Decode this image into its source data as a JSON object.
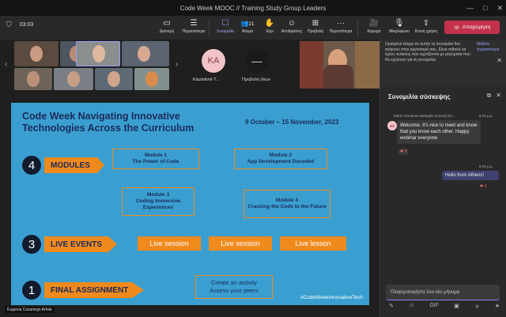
{
  "window": {
    "title": "Code Week MOOC // Training Study Group Leaders",
    "controls": [
      "—",
      "□",
      "✕"
    ]
  },
  "toolbar": {
    "timer": "03:03",
    "items": [
      {
        "icon": "▭",
        "label": "Διανομή"
      },
      {
        "icon": "☰",
        "label": "Περισσότερα"
      },
      {
        "icon": "☐",
        "label": "Συνομιλία"
      },
      {
        "icon": "👥",
        "label": "Άτομα"
      },
      {
        "icon": "✋",
        "label": "Χέρι"
      },
      {
        "icon": "☺",
        "label": "Αντιδράσεις"
      },
      {
        "icon": "⊞",
        "label": "Προβολή"
      },
      {
        "icon": "···",
        "label": "Περισσότερα"
      },
      {
        "icon": "🎥",
        "label": "Κάμερα"
      },
      {
        "icon": "🎙",
        "label": "Μικρόφωνο"
      },
      {
        "icon": "⇪",
        "label": "Κοινή χρήση"
      }
    ],
    "people_count": "21",
    "leave_label": "Αποχώρηση"
  },
  "participants": {
    "tile1_name": "Klaziskinë T...",
    "tile1_initials": "ΚΑ",
    "tile2_name": "Προβολή όλων",
    "tile2_icon": "—"
  },
  "slide": {
    "title": "Code Week Navigating Innovative Technologies Across the Curriculum",
    "dates": "9 October – 15 November, 2023",
    "modules_count": "4",
    "modules_label": "MODULES",
    "modules": [
      {
        "line1": "Module 1",
        "line2": "The Power of Code"
      },
      {
        "line1": "Module 2",
        "line2": "App Development Decoded"
      },
      {
        "line1": "Module 3",
        "line2": "Coding Immersive Experiences"
      },
      {
        "line1": "Module 4",
        "line2": "Cracking the Code to the Future"
      }
    ],
    "events_count": "3",
    "events_label": "LIVE EVENTS",
    "events": [
      "Live session",
      "Live session",
      "Live lesson"
    ],
    "assign_count": "1",
    "assign_label": "FINAL ASSIGNMENT",
    "assign_line1": "Create an activity",
    "assign_line2": "Assess your peers",
    "hashtag": "#CodeWeekInnovativeTech"
  },
  "presenter_caption": "Eugenia Casariego Arfole",
  "chat": {
    "notice": "Ορισμένα άτομα σε αυτήν τη συνομιλία δεν ανήκουν στον οργανισμό σας. Είναι πιθανό να έχουν τελικούς που σχετίζονται με μηνύματα που θα εχώσουν για τη συνομιλία.",
    "notice_link": "Μάθετε περισσότερα",
    "title": "Συνομιλία σύσκεψης",
    "msg1_author": "Maria Giovanna Battaglia (Guest) (Ετ...",
    "msg1_time": "6:03 μ.μ.",
    "msg1_initials": "MB",
    "msg1_text": "Welcome. It's nice to meet and know that you know each other. Happy webinar everyone",
    "msg1_reaction": "❤ 3",
    "msg2_time": "6:03 μ.μ.",
    "msg2_text": "Hello from Athens!",
    "msg2_reaction": "❤ 1",
    "compose_placeholder": "Πληκτρολογήστε ένα νέο μήνυμα",
    "compose_icons": [
      "✎",
      "☺",
      "GIF",
      "▣",
      "＋",
      "➤"
    ]
  }
}
